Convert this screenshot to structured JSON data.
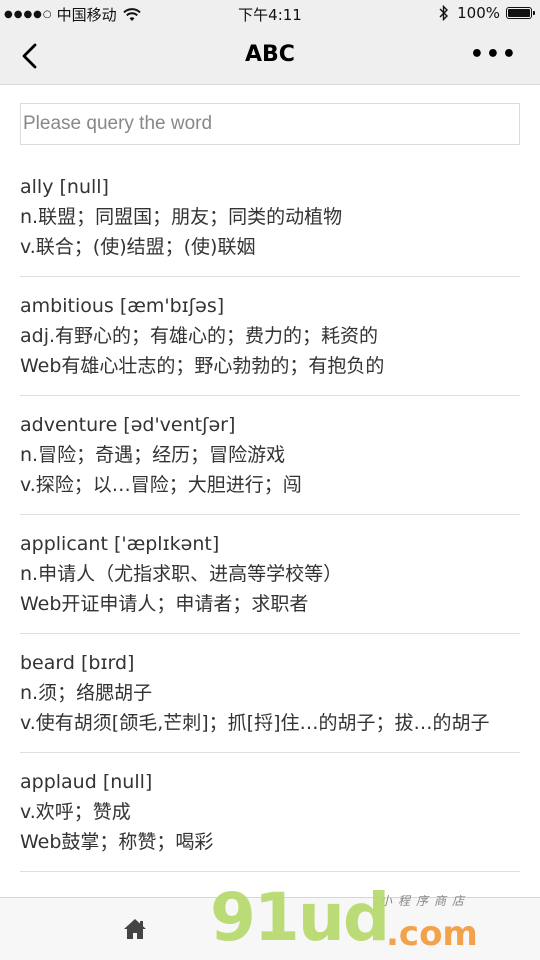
{
  "status_bar": {
    "carrier": "中国移动",
    "time": "下午4:11",
    "battery": "100%"
  },
  "nav": {
    "title": "ABC"
  },
  "search": {
    "placeholder": "Please query the word",
    "value": ""
  },
  "entries": [
    {
      "word": "ally [null]",
      "lines": [
        "n.联盟；同盟国；朋友；同类的动植物",
        "v.联合；(使)结盟；(使)联姻"
      ]
    },
    {
      "word": "ambitious [æm'bɪʃəs]",
      "lines": [
        "adj.有野心的；有雄心的；费力的；耗资的",
        "Web有雄心壮志的；野心勃勃的；有抱负的"
      ]
    },
    {
      "word": "adventure [əd'ventʃər]",
      "lines": [
        "n.冒险；奇遇；经历；冒险游戏",
        "v.探险；以…冒险；大胆进行；闯"
      ]
    },
    {
      "word": "applicant ['æplɪkənt]",
      "lines": [
        "n.申请人（尤指求职、进高等学校等）",
        "Web开证申请人；申请者；求职者"
      ]
    },
    {
      "word": "beard [bɪrd]",
      "lines": [
        "n.须；络腮胡子",
        "v.使有胡须[颌毛,芒刺]；抓[捋]住…的胡子；拔…的胡子"
      ]
    },
    {
      "word": "applaud [null]",
      "lines": [
        "v.欢呼；赞成",
        "Web鼓掌；称赞；喝彩"
      ]
    }
  ],
  "watermark": {
    "brand": "91ud",
    "suffix": ".com",
    "tagline": "小程序商店"
  },
  "icons": {
    "back": "back-arrow-icon",
    "more": "more-dots-icon",
    "home": "home-icon",
    "wifi": "wifi-icon",
    "bluetooth": "bluetooth-icon",
    "battery": "battery-icon",
    "signal": "signal-dots-icon"
  }
}
